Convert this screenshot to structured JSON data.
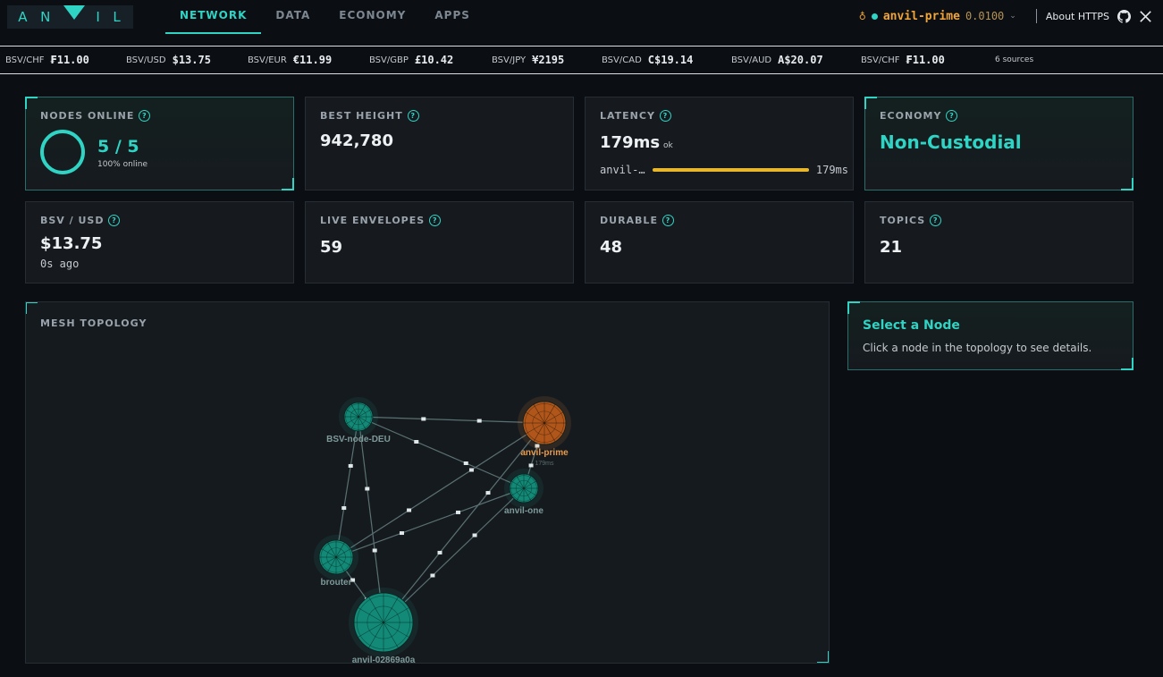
{
  "brand": {
    "letters": [
      "A",
      "N",
      "I",
      "L"
    ]
  },
  "nav": {
    "tabs": [
      {
        "label": "NETWORK",
        "active": true
      },
      {
        "label": "DATA",
        "active": false
      },
      {
        "label": "ECONOMY",
        "active": false
      },
      {
        "label": "APPS",
        "active": false
      }
    ],
    "node_name": "anvil-prime",
    "node_version": "0.0100",
    "about_label": "About HTTPS"
  },
  "ticker": {
    "items": [
      {
        "pair": "BSV/CHF",
        "price": "₣11.00"
      },
      {
        "pair": "BSV/USD",
        "price": "$13.75"
      },
      {
        "pair": "BSV/EUR",
        "price": "€11.99"
      },
      {
        "pair": "BSV/GBP",
        "price": "£10.42"
      },
      {
        "pair": "BSV/JPY",
        "price": "¥2195"
      },
      {
        "pair": "BSV/CAD",
        "price": "C$19.14"
      },
      {
        "pair": "BSV/AUD",
        "price": "A$20.07"
      },
      {
        "pair": "BSV/CHF",
        "price": "₣11.00"
      }
    ],
    "sources": "6 sources"
  },
  "stats": {
    "nodes_online": {
      "label": "NODES ONLINE",
      "value": "5 / 5",
      "sub": "100% online"
    },
    "best_height": {
      "label": "BEST HEIGHT",
      "value": "942,780"
    },
    "latency": {
      "label": "LATENCY",
      "value": "179ms",
      "status": "ok",
      "node": "anvil-…",
      "node_value": "179ms",
      "fill_fraction": 1.0
    },
    "economy": {
      "label": "ECONOMY",
      "value": "Non-Custodial"
    },
    "bsv_usd": {
      "label": "BSV / USD",
      "value": "$13.75",
      "sub": "0s ago"
    },
    "live_envelopes": {
      "label": "LIVE ENVELOPES",
      "value": "59"
    },
    "durable": {
      "label": "DURABLE",
      "value": "48"
    },
    "topics": {
      "label": "TOPICS",
      "value": "21"
    }
  },
  "topology": {
    "label": "MESH TOPOLOGY",
    "nodes": [
      {
        "id": "deu",
        "name": "BSV-node-DEU",
        "highlight": false
      },
      {
        "id": "prime",
        "name": "anvil-prime",
        "highlight": true,
        "latency": "179ms"
      },
      {
        "id": "one",
        "name": "anvil-one",
        "highlight": false
      },
      {
        "id": "brouter",
        "name": "brouter",
        "highlight": false
      },
      {
        "id": "big",
        "name": "anvil-02869a0a",
        "highlight": false
      }
    ],
    "edges": [
      [
        "deu",
        "prime"
      ],
      [
        "deu",
        "one"
      ],
      [
        "deu",
        "brouter"
      ],
      [
        "deu",
        "big"
      ],
      [
        "prime",
        "brouter"
      ],
      [
        "prime",
        "big"
      ],
      [
        "one",
        "brouter"
      ],
      [
        "one",
        "big"
      ],
      [
        "brouter",
        "big"
      ],
      [
        "prime",
        "one"
      ]
    ]
  },
  "detail": {
    "title": "Select a Node",
    "text": "Click a node in the topology to see details."
  },
  "colors": {
    "accent": "#2fd4c4",
    "warn": "#f0a53a",
    "bar": "#e8b72a",
    "node": "#138a77",
    "node_highlight": "#b0561a"
  }
}
